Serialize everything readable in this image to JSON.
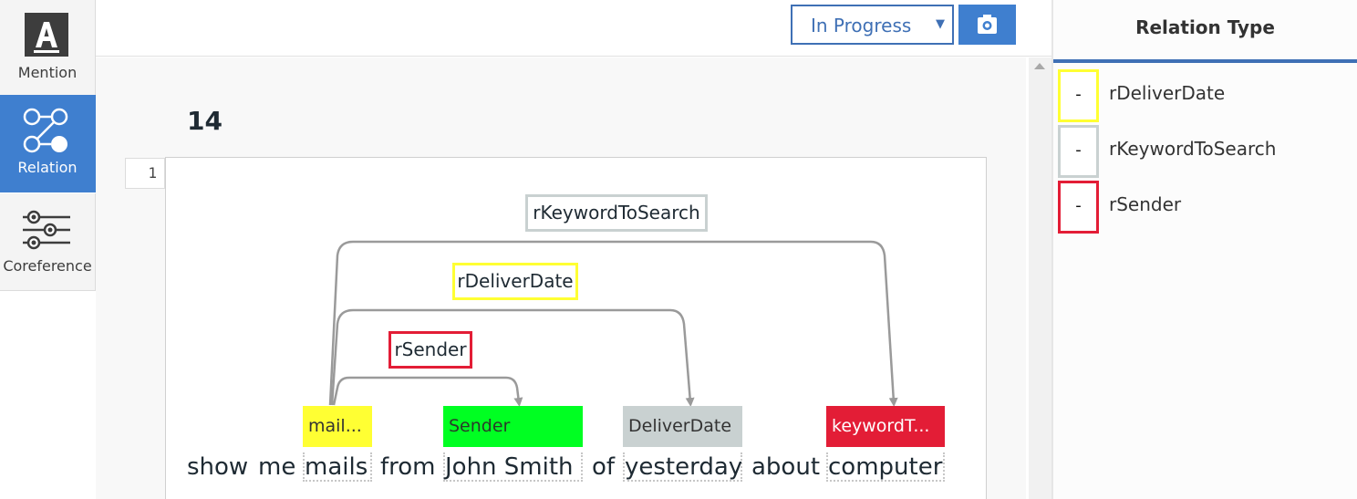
{
  "tools": [
    {
      "label": "Mention",
      "active": false,
      "icon": "text-a-icon"
    },
    {
      "label": "Relation",
      "active": true,
      "icon": "relation-nodes-icon"
    },
    {
      "label": "Coreference",
      "active": false,
      "icon": "sliders-icon"
    }
  ],
  "header": {
    "status_value": "In Progress",
    "capture_icon": "camera-icon"
  },
  "document": {
    "title": "14",
    "line_number": "1"
  },
  "tokens": [
    "show",
    "me",
    "mails",
    "from",
    "John Smith",
    "of",
    "yesterday",
    "about",
    "computer"
  ],
  "entities": [
    {
      "label": "mail...",
      "color": "#ffff33",
      "text_color": "#333333"
    },
    {
      "label": "Sender",
      "color": "#00ff22",
      "text_color": "#2a3b2a"
    },
    {
      "label": "DeliverDate",
      "color": "#c9d1d1",
      "text_color": "#333333"
    },
    {
      "label": "keywordT...",
      "color": "#e31d36",
      "text_color": "#ffffff"
    }
  ],
  "relations": [
    {
      "label": "rKeywordToSearch",
      "color": "#c9d1d1"
    },
    {
      "label": "rDeliverDate",
      "color": "#ffff33"
    },
    {
      "label": "rSender",
      "color": "#e31d36"
    }
  ],
  "panel": {
    "title": "Relation Type",
    "types": [
      {
        "swatch": "-",
        "name": "rDeliverDate",
        "color": "#ffff33"
      },
      {
        "swatch": "-",
        "name": "rKeywordToSearch",
        "color": "#c9d1d1"
      },
      {
        "swatch": "-",
        "name": "rSender",
        "color": "#e31d36"
      }
    ]
  }
}
